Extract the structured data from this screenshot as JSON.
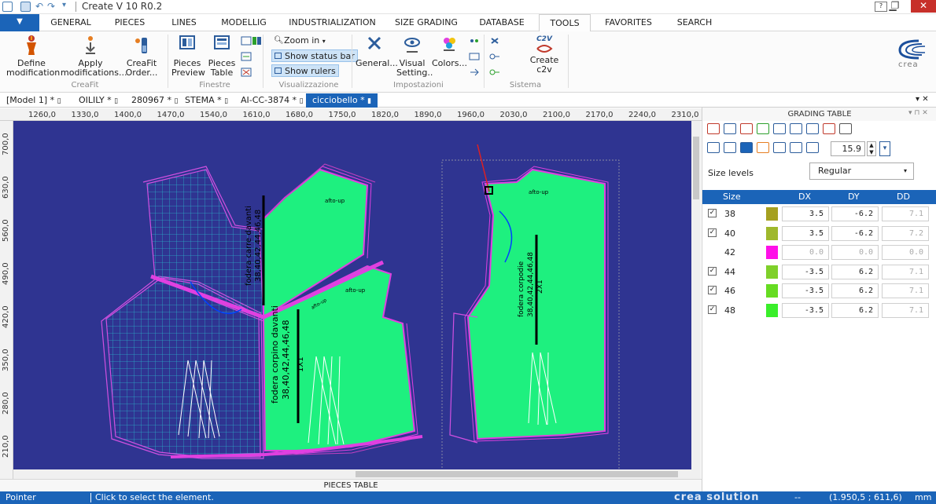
{
  "window": {
    "title": "Create V 10 R0.2"
  },
  "ribbon_tabs": [
    "GENERAL",
    "PIECES",
    "LINES",
    "MODELLIG",
    "INDUSTRIALIZATION",
    "SIZE GRADING",
    "DATABASE",
    "TOOLS",
    "FAVORITES",
    "SEARCH"
  ],
  "active_tab": "TOOLS",
  "ribbon": {
    "creafit": {
      "define": "Define modification",
      "apply": "Apply modifications...",
      "order": "CreaFit Order...",
      "group": "CreaFit"
    },
    "finestre": {
      "preview": "Pieces Preview",
      "table": "Pieces Table",
      "group": "Finestre"
    },
    "visualizzazione": {
      "zoom": "Zoom in",
      "status": "Show status bar",
      "rulers": "Show rulers",
      "group": "Visualizzazione"
    },
    "impostazioni": {
      "general": "General...",
      "visual": "Visual Setting..",
      "colors": "Colors...",
      "group": "Impostazioni"
    },
    "sistema": {
      "c2v_badge": "C2V",
      "c2v": "Create c2v",
      "group": "Sistema"
    }
  },
  "doc_tabs": [
    "[Model 1] *",
    "OILILY *",
    "280967 *",
    "STEMA *",
    "AI-CC-3874 *",
    "cicciobello *"
  ],
  "active_doc": "cicciobello *",
  "ruler": {
    "x_ticks": [
      "1260,0",
      "1330,0",
      "1400,0",
      "1470,0",
      "1540,0",
      "1610,0",
      "1680,0",
      "1750,0",
      "1820,0",
      "1890,0",
      "1960,0",
      "2030,0",
      "2100,0",
      "2170,0",
      "2240,0",
      "2310,0"
    ],
    "y_ticks": [
      "700,0",
      "630,0",
      "560,0",
      "490,0",
      "420,0",
      "350,0",
      "280,0",
      "210,0"
    ]
  },
  "canvas": {
    "bg_color": "#2f3491",
    "piece_fill": "#1ef07f",
    "piece_outline": "#e040e0",
    "labels": {
      "carre": "fodera carre davanti",
      "carre_sizes": "38,40,42,44,46,48",
      "corpino": "fodera corpino davanti",
      "corpino_sizes": "38,40,42,44,46,48",
      "corpino_qty": "1X1",
      "dietro": "fodera corpodie",
      "dietro_sizes": "38,40,42,44,46,48",
      "dietro_qty": "2X1",
      "tag_a": "afto-up",
      "tag_b": "afto-up",
      "tag_c": "afto-up",
      "tag_d": "afto-up"
    }
  },
  "pieces_table": "PIECES TABLE",
  "grading": {
    "title": "GRADING TABLE",
    "value": "15.9",
    "size_levels_label": "Size levels",
    "size_levels_value": "Regular",
    "columns": [
      "Size",
      "DX",
      "DY",
      "DD"
    ],
    "rows": [
      {
        "size": "38",
        "checked": true,
        "color": "#a5a020",
        "dx": "3.5",
        "dy": "-6.2",
        "dd": "7.1"
      },
      {
        "size": "40",
        "checked": true,
        "color": "#9fb82c",
        "dx": "3.5",
        "dy": "-6.2",
        "dd": "7.2"
      },
      {
        "size": "42",
        "checked": false,
        "color": "#ff10e8",
        "dx": "0.0",
        "dy": "0.0",
        "dd": "0.0"
      },
      {
        "size": "44",
        "checked": true,
        "color": "#7fd02a",
        "dx": "-3.5",
        "dy": "6.2",
        "dd": "7.1"
      },
      {
        "size": "46",
        "checked": true,
        "color": "#66dc22",
        "dx": "-3.5",
        "dy": "6.2",
        "dd": "7.1"
      },
      {
        "size": "48",
        "checked": true,
        "color": "#3aee2a",
        "dx": "-3.5",
        "dy": "6.2",
        "dd": "7.1"
      }
    ]
  },
  "status": {
    "mode": "Pointer",
    "hint": "Click to select the element.",
    "brand": "crea solution",
    "sep": "--",
    "coords": "(1.950,5 ; 611,6)",
    "unit": "mm"
  }
}
